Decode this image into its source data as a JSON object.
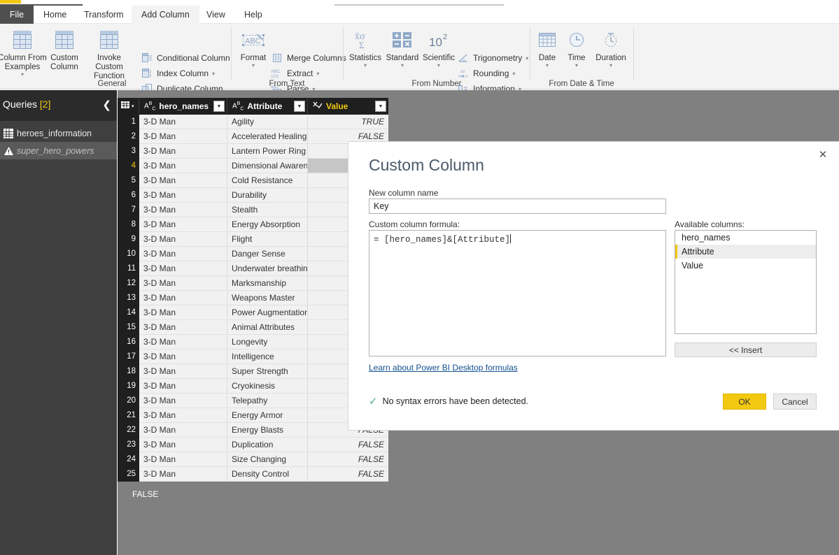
{
  "window": {
    "app_accent": "#f2c811"
  },
  "ribbon": {
    "tabs": [
      {
        "label": "File",
        "active": false,
        "id": "file"
      },
      {
        "label": "Home",
        "active": false,
        "id": "home"
      },
      {
        "label": "Transform",
        "active": false,
        "id": "transform"
      },
      {
        "label": "Add Column",
        "active": true,
        "id": "add-column"
      },
      {
        "label": "View",
        "active": false,
        "id": "view"
      },
      {
        "label": "Help",
        "active": false,
        "id": "help"
      }
    ],
    "groups": [
      {
        "id": "general",
        "label": "General"
      },
      {
        "id": "from-text",
        "label": "From Text"
      },
      {
        "id": "from-number",
        "label": "From Number"
      },
      {
        "id": "from-date-time",
        "label": "From Date & Time"
      }
    ],
    "general": {
      "column_from_examples": "Column From Examples",
      "column_from_examples_l1": "Column From",
      "column_from_examples_l2": "Examples",
      "custom_column_l1": "Custom",
      "custom_column_l2": "Column",
      "invoke_custom_function_l1": "Invoke Custom",
      "invoke_custom_function_l2": "Function",
      "conditional_column": "Conditional Column",
      "index_column": "Index Column",
      "duplicate_column": "Duplicate Column"
    },
    "from_text": {
      "format": "Format",
      "merge_columns": "Merge Columns",
      "extract": "Extract",
      "parse": "Parse",
      "format_icon_text": "ABC",
      "extract_icon_text": "ABC\n123",
      "parse_icon_text": "abc"
    },
    "from_number": {
      "statistics": "Statistics",
      "standard": "Standard",
      "scientific": "Scientific",
      "trigonometry": "Trigonometry",
      "rounding": "Rounding",
      "information": "Information"
    },
    "from_date_time": {
      "date": "Date",
      "time": "Time",
      "duration": "Duration"
    }
  },
  "queries_pane": {
    "title": "Queries",
    "count": "[2]",
    "collapse_icon": "chevron-left",
    "items": [
      {
        "label": "heroes_information",
        "icon": "table-icon",
        "selected": false
      },
      {
        "label": "super_hero_powers",
        "icon": "warning-icon",
        "selected": true
      }
    ]
  },
  "table": {
    "columns": [
      {
        "name": "hero_names",
        "type_icon": "ABC",
        "highlight": false
      },
      {
        "name": "Attribute",
        "type_icon": "ABC",
        "highlight": false
      },
      {
        "name": "Value",
        "type_icon": "any",
        "highlight": true
      }
    ],
    "selected_row": 4,
    "bottom_status_value": "FALSE",
    "rows": [
      {
        "n": "1",
        "hero_names": "3-D Man",
        "attribute": "Agility",
        "value": "TRUE"
      },
      {
        "n": "2",
        "hero_names": "3-D Man",
        "attribute": "Accelerated Healing",
        "value": "FALSE"
      },
      {
        "n": "3",
        "hero_names": "3-D Man",
        "attribute": "Lantern Power Ring",
        "value": ""
      },
      {
        "n": "4",
        "hero_names": "3-D Man",
        "attribute": "Dimensional Awaren...",
        "value": ""
      },
      {
        "n": "5",
        "hero_names": "3-D Man",
        "attribute": "Cold Resistance",
        "value": ""
      },
      {
        "n": "6",
        "hero_names": "3-D Man",
        "attribute": "Durability",
        "value": ""
      },
      {
        "n": "7",
        "hero_names": "3-D Man",
        "attribute": "Stealth",
        "value": ""
      },
      {
        "n": "8",
        "hero_names": "3-D Man",
        "attribute": "Energy Absorption",
        "value": ""
      },
      {
        "n": "9",
        "hero_names": "3-D Man",
        "attribute": "Flight",
        "value": ""
      },
      {
        "n": "10",
        "hero_names": "3-D Man",
        "attribute": "Danger Sense",
        "value": ""
      },
      {
        "n": "11",
        "hero_names": "3-D Man",
        "attribute": "Underwater breathing",
        "value": ""
      },
      {
        "n": "12",
        "hero_names": "3-D Man",
        "attribute": "Marksmanship",
        "value": ""
      },
      {
        "n": "13",
        "hero_names": "3-D Man",
        "attribute": "Weapons Master",
        "value": ""
      },
      {
        "n": "14",
        "hero_names": "3-D Man",
        "attribute": "Power Augmentation",
        "value": ""
      },
      {
        "n": "15",
        "hero_names": "3-D Man",
        "attribute": "Animal Attributes",
        "value": ""
      },
      {
        "n": "16",
        "hero_names": "3-D Man",
        "attribute": "Longevity",
        "value": ""
      },
      {
        "n": "17",
        "hero_names": "3-D Man",
        "attribute": "Intelligence",
        "value": ""
      },
      {
        "n": "18",
        "hero_names": "3-D Man",
        "attribute": "Super Strength",
        "value": ""
      },
      {
        "n": "19",
        "hero_names": "3-D Man",
        "attribute": "Cryokinesis",
        "value": ""
      },
      {
        "n": "20",
        "hero_names": "3-D Man",
        "attribute": "Telepathy",
        "value": ""
      },
      {
        "n": "21",
        "hero_names": "3-D Man",
        "attribute": "Energy Armor",
        "value": ""
      },
      {
        "n": "22",
        "hero_names": "3-D Man",
        "attribute": "Energy Blasts",
        "value": "FALSE"
      },
      {
        "n": "23",
        "hero_names": "3-D Man",
        "attribute": "Duplication",
        "value": "FALSE"
      },
      {
        "n": "24",
        "hero_names": "3-D Man",
        "attribute": "Size Changing",
        "value": "FALSE"
      },
      {
        "n": "25",
        "hero_names": "3-D Man",
        "attribute": "Density Control",
        "value": "FALSE"
      }
    ]
  },
  "dialog": {
    "title": "Custom Column",
    "close_icon": "close-icon",
    "new_column_name_label": "New column name",
    "new_column_name_value": "Key",
    "formula_label": "Custom column formula:",
    "formula_value": "= [hero_names]&[Attribute]",
    "learn_link": "Learn about Power BI Desktop formulas",
    "available_columns_label": "Available columns:",
    "available_columns": [
      {
        "label": "hero_names",
        "selected": false
      },
      {
        "label": "Attribute",
        "selected": true
      },
      {
        "label": "Value",
        "selected": false
      }
    ],
    "insert_button": "<< Insert",
    "status_icon": "check-icon",
    "status_text": "No syntax errors have been detected.",
    "ok_button": "OK",
    "cancel_button": "Cancel"
  }
}
